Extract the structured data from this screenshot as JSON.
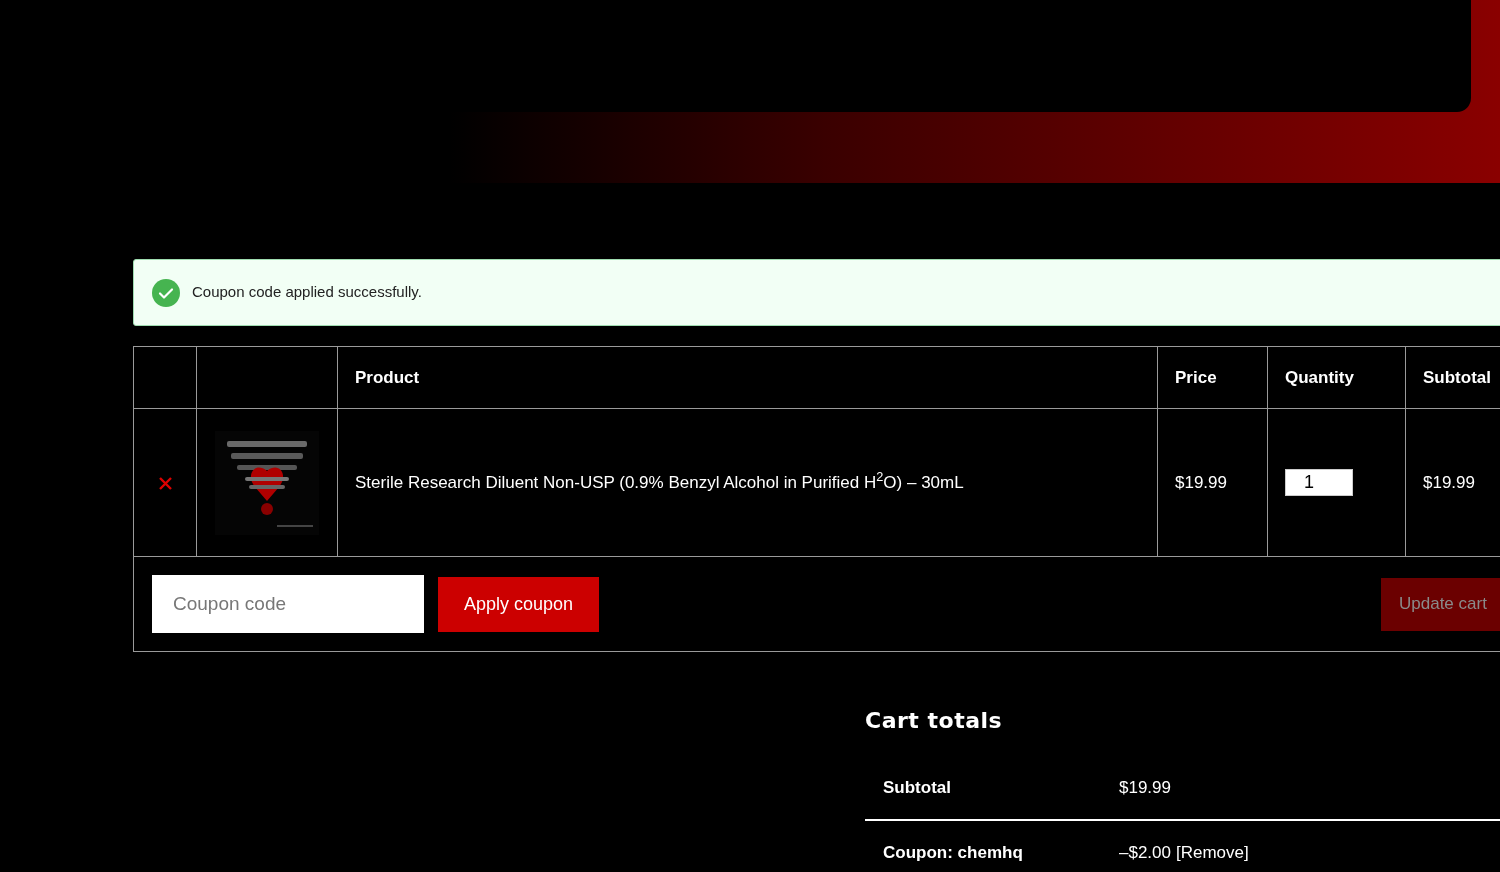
{
  "notice": {
    "kind": "success",
    "message": "Coupon code applied successfully."
  },
  "cart_table": {
    "columns": [
      "Product",
      "Price",
      "Quantity",
      "Subtotal"
    ],
    "rows": [
      {
        "product": "Sterile Research Diluent Non-USP (0.9% Benzyl Alcohol in Purified H$^{2}$O) – 30mL",
        "price": "$19.99",
        "quantity": "1",
        "subtotal": "$19.99"
      }
    ],
    "coupon_placeholder": "Coupon code",
    "apply_button": "Apply coupon",
    "update_button": {
      "label": "Update cart",
      "disabled": true
    }
  },
  "cart_totals": {
    "title": "Cart totals",
    "rows": [
      {
        "label": "Subtotal",
        "value": "$19.99"
      },
      {
        "label": "Coupon: chemhq",
        "value": "–$2.00",
        "link": "[Remove]"
      }
    ]
  }
}
